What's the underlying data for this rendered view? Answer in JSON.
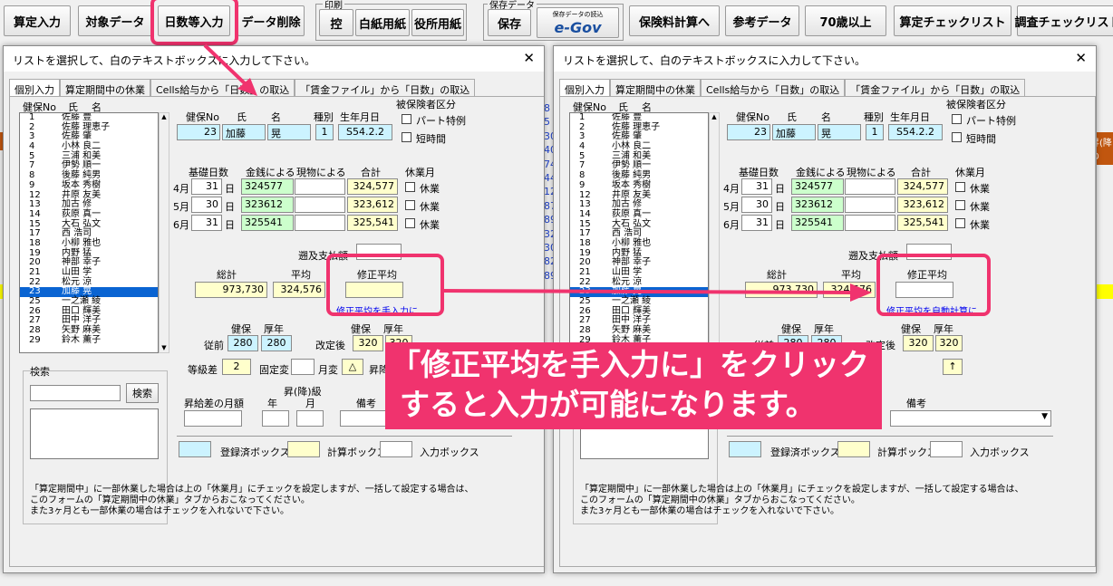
{
  "toolbar": {
    "buttons": [
      "算定入力",
      "対象データ",
      "日数等入力",
      "データ削除"
    ],
    "print_group": "印刷",
    "print_buttons": [
      "控",
      "白紙用紙",
      "役所用紙"
    ],
    "save_group": "保存データ",
    "save_button": "保存",
    "egov_small": "保存データの読込",
    "egov_logo": "e-Gov",
    "right_buttons": [
      "保険料計算へ",
      "参考データ",
      "70歳以上",
      "算定チェックリスト",
      "調査チェックリスト"
    ]
  },
  "dialog": {
    "title": "リストを選択して、白のテキストボックスに入力して下さい。",
    "close": "✕",
    "tabs": [
      "個別入力",
      "算定期間中の休業",
      "Cells給与から「日数」の取込",
      "「賃金ファイル」から「日数」の取込"
    ],
    "list_headers": [
      "健保No",
      "氏",
      "名"
    ],
    "employees": [
      {
        "no": "1",
        "name": "佐藤 豊"
      },
      {
        "no": "2",
        "name": "佐藤 理恵子"
      },
      {
        "no": "3",
        "name": "佐藤 肇"
      },
      {
        "no": "4",
        "name": "小林 良二"
      },
      {
        "no": "5",
        "name": "三浦 和美"
      },
      {
        "no": "7",
        "name": "伊勢 順一"
      },
      {
        "no": "8",
        "name": "後藤 純男"
      },
      {
        "no": "9",
        "name": "坂本 秀樹"
      },
      {
        "no": "12",
        "name": "井原 友美"
      },
      {
        "no": "13",
        "name": "加古 修"
      },
      {
        "no": "14",
        "name": "荻原 真一"
      },
      {
        "no": "15",
        "name": "大石 弘文"
      },
      {
        "no": "17",
        "name": "西 浩司"
      },
      {
        "no": "18",
        "name": "小柳 雅也"
      },
      {
        "no": "19",
        "name": "内野 猛"
      },
      {
        "no": "20",
        "name": "神部 幸子"
      },
      {
        "no": "21",
        "name": "山田 学"
      },
      {
        "no": "22",
        "name": "松元 涼"
      },
      {
        "no": "23",
        "name": "加藤 晃"
      },
      {
        "no": "25",
        "name": "一之瀬 綾"
      },
      {
        "no": "26",
        "name": "田口 輝美"
      },
      {
        "no": "27",
        "name": "田中 洋子"
      },
      {
        "no": "28",
        "name": "矢野 麻美"
      },
      {
        "no": "29",
        "name": "鈴木 薫子"
      }
    ],
    "hdr_labels": [
      "健保No",
      "氏",
      "名",
      "種別",
      "生年月日"
    ],
    "insured_class": "被保険者区分",
    "part_time": "パート特例",
    "short_time": "短時間",
    "rec": {
      "no": "23",
      "last": "加藤",
      "first": "晃",
      "kind": "1",
      "birth": "S54.2.2"
    },
    "col_labels": [
      "基礎日数",
      "金銭による",
      "現物による",
      "合計",
      "休業月"
    ],
    "months": [
      {
        "m": "4月",
        "days": "31",
        "unit": "日",
        "cash": "324577",
        "total": "324,577",
        "leave": "休業"
      },
      {
        "m": "5月",
        "days": "30",
        "unit": "日",
        "cash": "323612",
        "total": "323,612",
        "leave": "休業"
      },
      {
        "m": "6月",
        "days": "31",
        "unit": "日",
        "cash": "325541",
        "total": "325,541",
        "leave": "休業"
      }
    ],
    "retro": "遡及支払額",
    "sum_label": "総計",
    "avg_label": "平均",
    "mod_label": "修正平均",
    "sum": "973,730",
    "avg": "324,576",
    "link_manual": "修正平均を手入力に",
    "link_auto": "修正平均を自動計算に",
    "kenpo": "健保",
    "kounen": "厚年",
    "prev": "従前",
    "after": "改定後",
    "prev_k": "280",
    "prev_n": "280",
    "after_k": "320",
    "after_n": "320",
    "grade_diff": "等級差",
    "grade_val": "2",
    "fixed": "固定変",
    "month_change": "月変",
    "triangle": "△",
    "updown": "昇降",
    "arrow": "↑",
    "search": "検索",
    "search_btn": "検索",
    "raise_month": "昇給差の月額",
    "raise_grade": "昇(降)級",
    "year": "年",
    "month": "月",
    "remarks": "備考",
    "legend": [
      "登録済ボックス",
      "計算ボックス",
      "入力ボックス"
    ],
    "note": "「算定期間中」に一部休業した場合は上の「休業月」にチェックを設定しますが、一括して設定する場合は、\nこのフォームの「算定期間中の休業」タブからおこなってください。\nまた3ヶ月とも一部休業の場合はチェックを入れないで下さい。"
  },
  "caption": {
    "line1": "「修正平均を手入力に」をクリック",
    "line2": "すると入力が可能になります。"
  },
  "bg_fragments": {
    "right_edge": "昇(降\nの",
    "mid_nums": "8\n5\n30\n40\n74\n44\n12\n87\n89\n32\n30\n82\n89"
  },
  "colors": {
    "accent": "#f0336e",
    "registered": "#ccf3ff",
    "calc": "#ffffcc",
    "selected": "#0a64d2",
    "cash": "#ccffcc"
  }
}
